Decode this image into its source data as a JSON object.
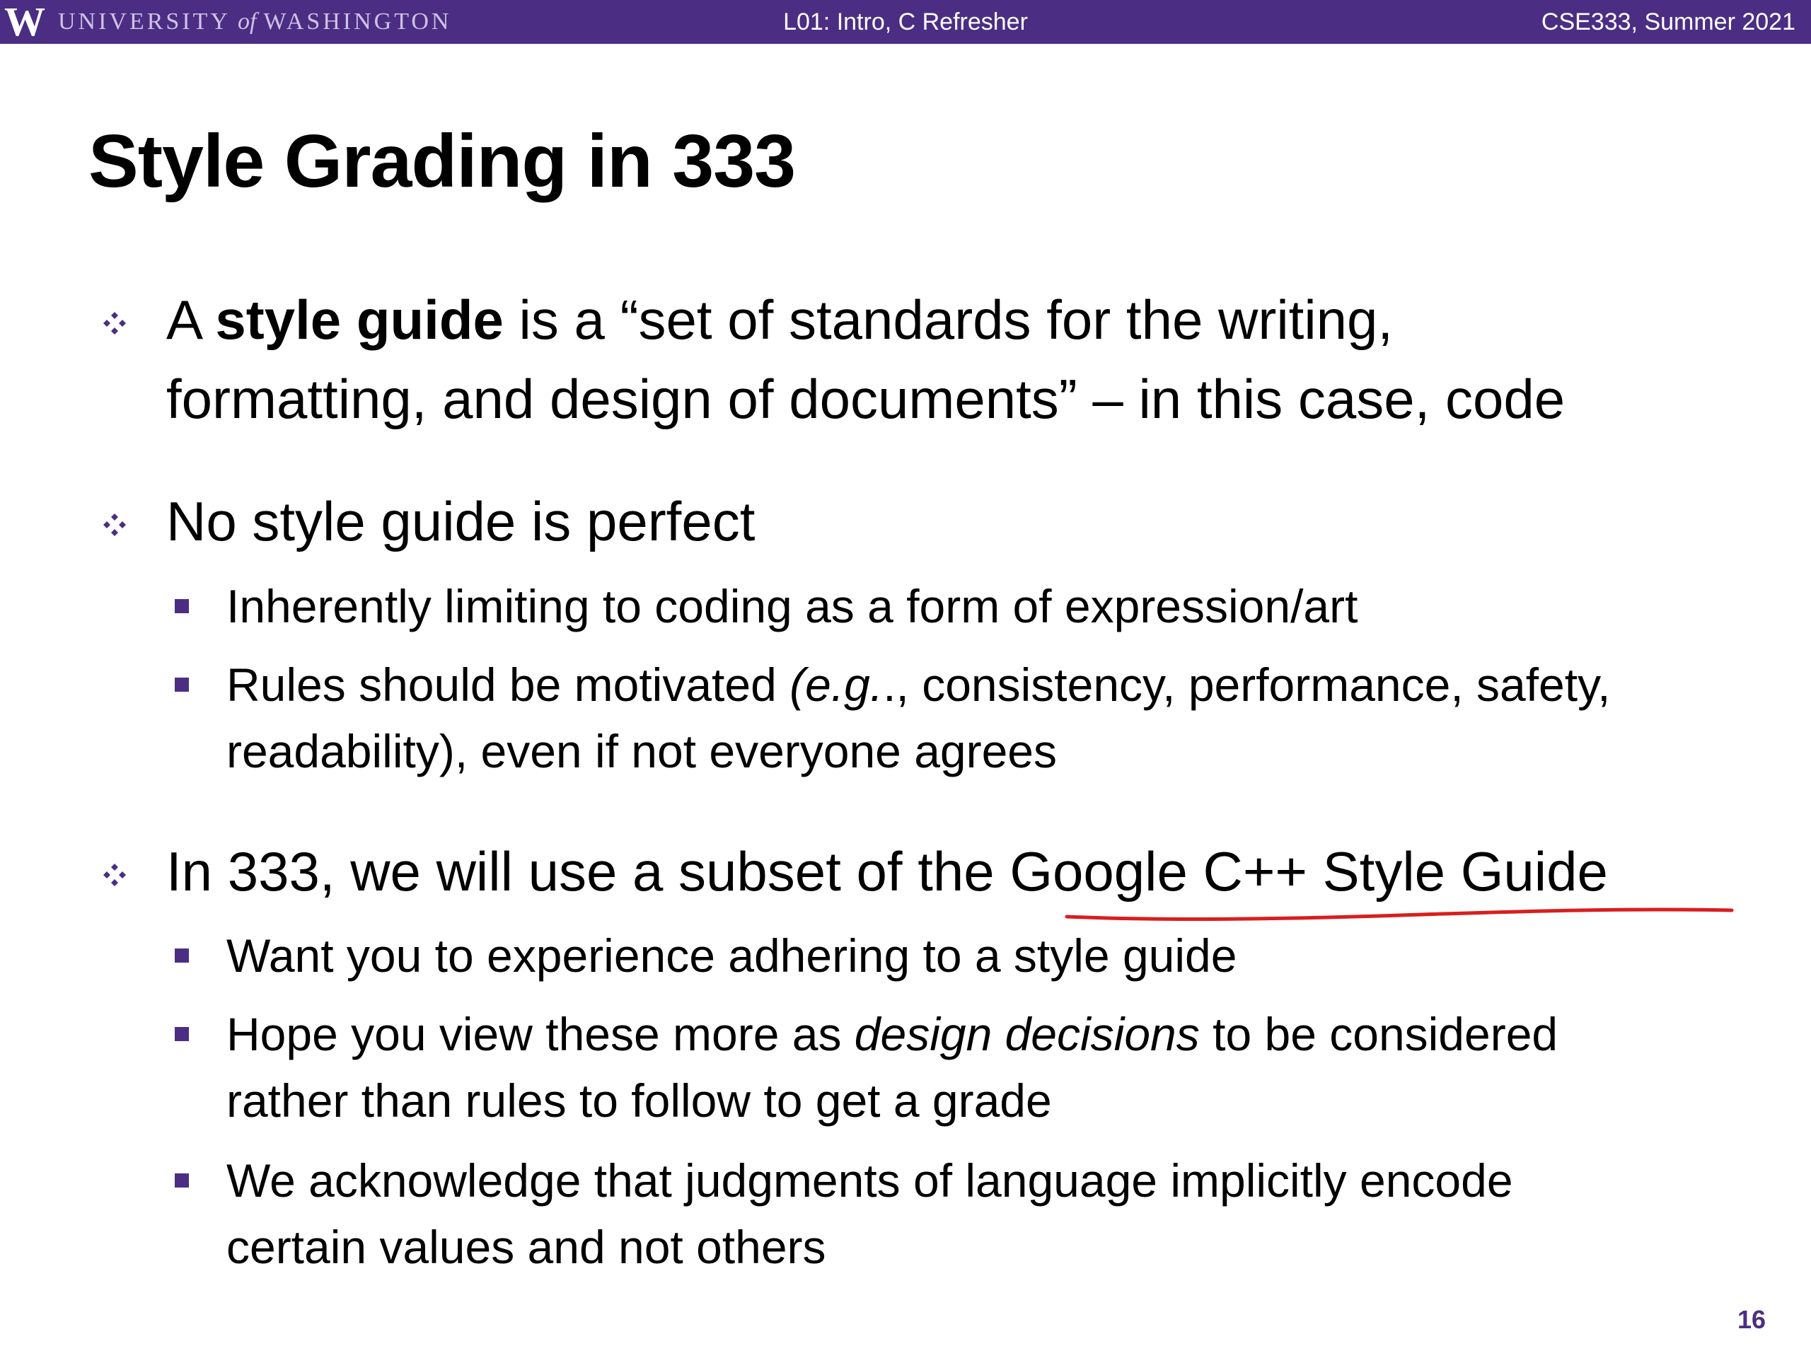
{
  "header": {
    "logo_letter": "W",
    "university_part1": "UNIVERSITY",
    "university_of": "of",
    "university_part2": "WASHINGTON",
    "lecture": "L01:  Intro, C Refresher",
    "course": "CSE333, Summer 2021"
  },
  "slide": {
    "title": "Style Grading in 333",
    "bullets": [
      {
        "pre": "A ",
        "bold": "style guide",
        "post_line1": " is a “set of standards for the writing,",
        "line2": "formatting, and design of documents” – in this case, code"
      },
      {
        "text": "No style guide is perfect",
        "subs": [
          {
            "text": "Inherently limiting to coding as a form of expression/art"
          },
          {
            "pre": "Rules should be motivated ",
            "italic": "(e.g.",
            "post_line1": "., consistency, performance, safety,",
            "line2": "readability), even if not everyone agrees"
          }
        ]
      },
      {
        "text": "In 333, we will use a subset of the Google C++ Style Guide",
        "subs": [
          {
            "text": "Want you to experience adhering to a style guide"
          },
          {
            "pre": "Hope you view these more as ",
            "italic": "design decisions",
            "post_line1": " to be considered",
            "line2": "rather than rules to follow to get a grade"
          },
          {
            "line1": "We acknowledge that judgments of language implicitly encode",
            "line2": "certain values and not others"
          }
        ]
      }
    ]
  },
  "page_number": "16",
  "colors": {
    "brand_purple": "#4b2e83",
    "annotation_red": "#d81e1e"
  },
  "icons": {
    "bullet_level1": "four-diamond-bullet-icon",
    "bullet_level2": "square-bullet-icon"
  }
}
